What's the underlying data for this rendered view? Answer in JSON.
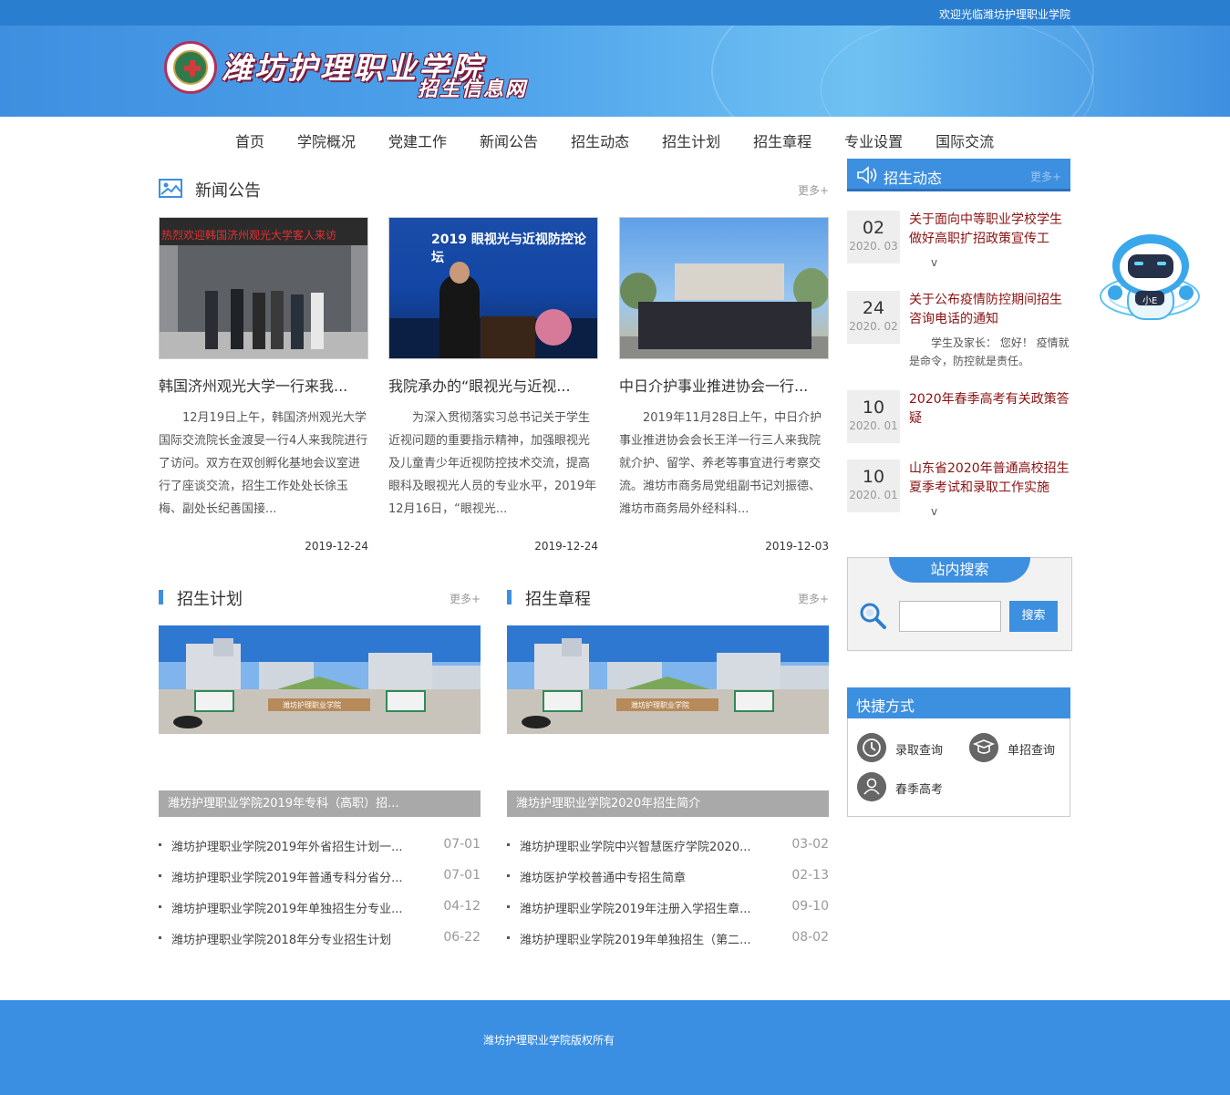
{
  "topbar": {
    "welcome": "欢迎光临潍坊护理职业学院"
  },
  "header": {
    "school_name": "潍坊护理职业学院",
    "subtitle": "招生信息网",
    "logo_icon": "school-seal-icon"
  },
  "nav": {
    "items": [
      "首页",
      "学院概况",
      "党建工作",
      "新闻公告",
      "招生动态",
      "招生计划",
      "招生章程",
      "专业设置",
      "国际交流"
    ]
  },
  "news": {
    "title": "新闻公告",
    "more": "更多+",
    "cards": [
      {
        "title": "韩国济州观光大学一行来我...",
        "desc": "12月19日上午，韩国济州观光大学国际交流院长金渡旻一行4人来我院进行了访问。双方在双创孵化基地会议室进行了座谈交流，招生工作处处长徐玉梅、副处长纪善国接...",
        "date": "2019-12-24",
        "banner_text": "热烈欢迎韩国济州观光大学客人来访"
      },
      {
        "title": "我院承办的“眼视光与近视...",
        "desc": "为深入贯彻落实习总书记关于学生近视问题的重要指示精神，加强眼视光及儿童青少年近视防控技术交流，提高眼科及眼视光人员的专业水平，2019年12月16日，“眼视光...",
        "date": "2019-12-24",
        "banner_text": "2019 眼视光与近视防控论坛"
      },
      {
        "title": "中日介护事业推进协会一行...",
        "desc": "2019年11月28日上午，中日介护事业推进协会会长王洋一行三人来我院就介护、留学、养老等事宜进行考察交流。潍坊市商务局党组副书记刘振德、潍坊市商务局外经科科...",
        "date": "2019-12-03"
      }
    ]
  },
  "dynamics": {
    "title": "招生动态",
    "more": "更多+",
    "items": [
      {
        "day": "02",
        "ym": "2020. 03",
        "title": "关于面向中等职业学校学生做好高职扩招政策宣传工",
        "sub": "v"
      },
      {
        "day": "24",
        "ym": "2020. 02",
        "title": "关于公布疫情防控期间招生咨询电话的通知",
        "sub": "学生及家长：  您好！  疫情就是命令，防控就是责任。"
      },
      {
        "day": "10",
        "ym": "2020. 01",
        "title": "2020年春季高考有关政策答疑",
        "sub": ""
      },
      {
        "day": "10",
        "ym": "2020. 01",
        "title": "山东省2020年普通高校招生夏季考试和录取工作实施",
        "sub": "v"
      }
    ]
  },
  "search": {
    "title": "站内搜索",
    "placeholder": "",
    "button": "搜索"
  },
  "quick": {
    "title": "快捷方式",
    "items": [
      {
        "label": "录取查询",
        "icon": "clock-icon"
      },
      {
        "label": "单招查询",
        "icon": "graduation-cap-icon"
      },
      {
        "label": "春季高考",
        "icon": "user-icon"
      }
    ]
  },
  "robot": {
    "label": "小E"
  },
  "plan": {
    "title": "招生计划",
    "more": "更多+",
    "campus_sign": "潍坊护理职业学院",
    "caption": "潍坊护理职业学院2019年专科（高职）招...",
    "items": [
      {
        "text": "潍坊护理职业学院2019年外省招生计划一...",
        "date": "07-01"
      },
      {
        "text": "潍坊护理职业学院2019年普通专科分省分...",
        "date": "07-01"
      },
      {
        "text": "潍坊护理职业学院2019年单独招生分专业...",
        "date": "04-12"
      },
      {
        "text": "潍坊护理职业学院2018年分专业招生计划",
        "date": "06-22"
      }
    ]
  },
  "charter": {
    "title": "招生章程",
    "more": "更多+",
    "campus_sign": "潍坊护理职业学院",
    "caption": "潍坊护理职业学院2020年招生简介",
    "items": [
      {
        "text": "潍坊护理职业学院中兴智慧医疗学院2020...",
        "date": "03-02"
      },
      {
        "text": "潍坊医护学校普通中专招生简章",
        "date": "02-13"
      },
      {
        "text": "潍坊护理职业学院2019年注册入学招生章...",
        "date": "09-10"
      },
      {
        "text": "潍坊护理职业学院2019年单独招生（第二...",
        "date": "08-02"
      }
    ]
  },
  "footer": {
    "copyright": "潍坊护理职业学院版权所有"
  }
}
